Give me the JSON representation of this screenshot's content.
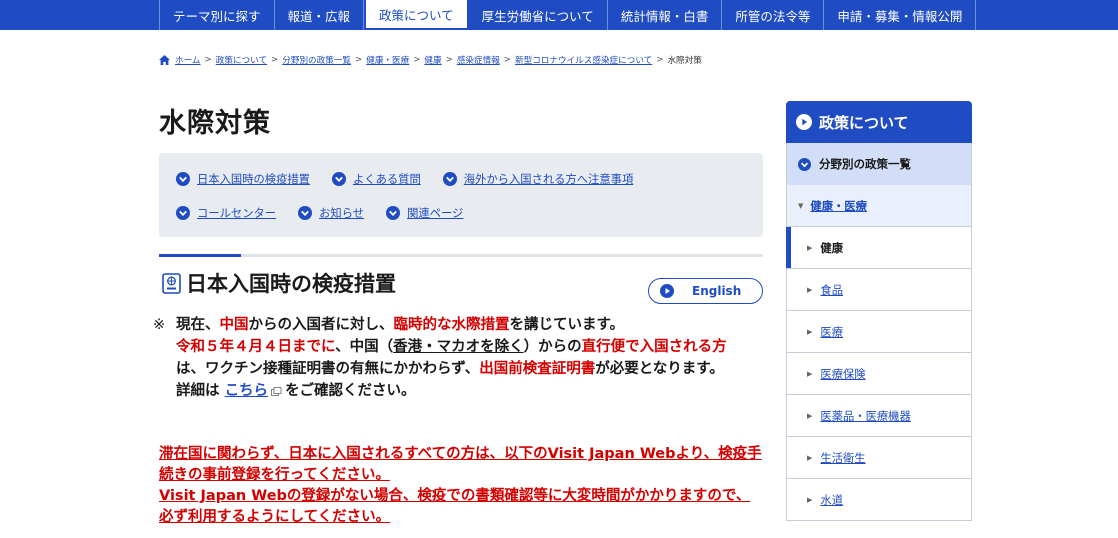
{
  "topnav": {
    "items": [
      {
        "label": "テーマ別に探す"
      },
      {
        "label": "報道・広報"
      },
      {
        "label": "政策について",
        "active": true
      },
      {
        "label": "厚生労働省について"
      },
      {
        "label": "統計情報・白書"
      },
      {
        "label": "所管の法令等"
      },
      {
        "label": "申請・募集・情報公開"
      }
    ]
  },
  "breadcrumb": {
    "links": [
      "ホーム",
      "政策について",
      "分野別の政策一覧",
      "健康・医療",
      "健康",
      "感染症情報",
      "新型コロナウイルス感染症について"
    ],
    "separator": ">",
    "current": "水際対策"
  },
  "page": {
    "title": "水際対策"
  },
  "anchors": {
    "row1": [
      "日本入国時の検疫措置",
      "よくある質問",
      "海外から入国される方へ注意事項"
    ],
    "row2": [
      "コールセンター",
      "お知らせ",
      "関連ページ"
    ]
  },
  "section": {
    "heading": "日本入国時の検疫措置",
    "english_label": "English"
  },
  "notice": {
    "mark": "※",
    "l1_a": "現在、",
    "l1_b": "中国",
    "l1_c": "からの入国者に対し、",
    "l1_d": "臨時的な水際措置",
    "l1_e": "を講じています。",
    "l2_a": "令和５年４月４日までに",
    "l2_b": "、中国（",
    "l2_c": "香港・マカオを除く",
    "l2_d": "）からの",
    "l2_e": "直行便で入国される方",
    "l3_a": "は、ワクチン接種証明書の有無にかかわらず、",
    "l3_b": "出国前検査証明書",
    "l3_c": "が必要となります。",
    "l4_a": "詳細は",
    "l4_link": "こちら",
    "l4_b": "をご確認ください。"
  },
  "visit": {
    "p1": "滞在国に関わらず、日本に入国されるすべての方は、以下のVisit Japan Webより、検疫手続きの事前登録を行ってください。",
    "p2": "Visit Japan Webの登録がない場合、検疫での書類確認等に大変時間がかかりますので、必ず利用するようにしてください。"
  },
  "sidebar": {
    "heading": "政策について",
    "sub": "分野別の政策一覧",
    "category": "健康・医療",
    "items": [
      {
        "label": "健康",
        "active": true
      },
      {
        "label": "食品"
      },
      {
        "label": "医療"
      },
      {
        "label": "医療保険"
      },
      {
        "label": "医薬品・医療機器"
      },
      {
        "label": "生活衛生"
      },
      {
        "label": "水道"
      }
    ]
  },
  "colors": {
    "brand_blue": "#1f4cc2",
    "alert_red": "#d40000",
    "panel_gray": "#e8ebef"
  },
  "icons": [
    "home-icon",
    "circle-down-icon",
    "passport-icon",
    "circle-play-icon",
    "external-link-icon",
    "triangle-right-icon"
  ]
}
